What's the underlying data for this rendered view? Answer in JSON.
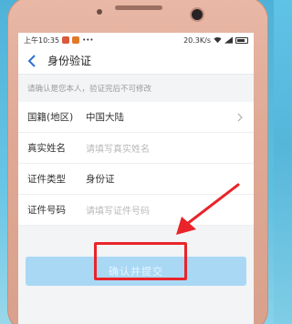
{
  "status_bar": {
    "time": "上午10:35",
    "network_speed": "20.3K/s"
  },
  "header": {
    "title": "身份验证",
    "back_icon": "back-arrow-icon"
  },
  "hint_text": "请确认是您本人，验证完后不可修改",
  "form": {
    "rows": [
      {
        "label": "国籍(地区)",
        "value": "中国大陆",
        "placeholder": ""
      },
      {
        "label": "真实姓名",
        "value": "",
        "placeholder": "请填写真实姓名"
      },
      {
        "label": "证件类型",
        "value": "身份证",
        "placeholder": ""
      },
      {
        "label": "证件号码",
        "value": "",
        "placeholder": "请填写证件号码"
      }
    ]
  },
  "submit_label": "确认并提交",
  "colors": {
    "accent": "#a9d8f5",
    "highlight": "#e8242a",
    "back_arrow": "#2f6fd6"
  }
}
